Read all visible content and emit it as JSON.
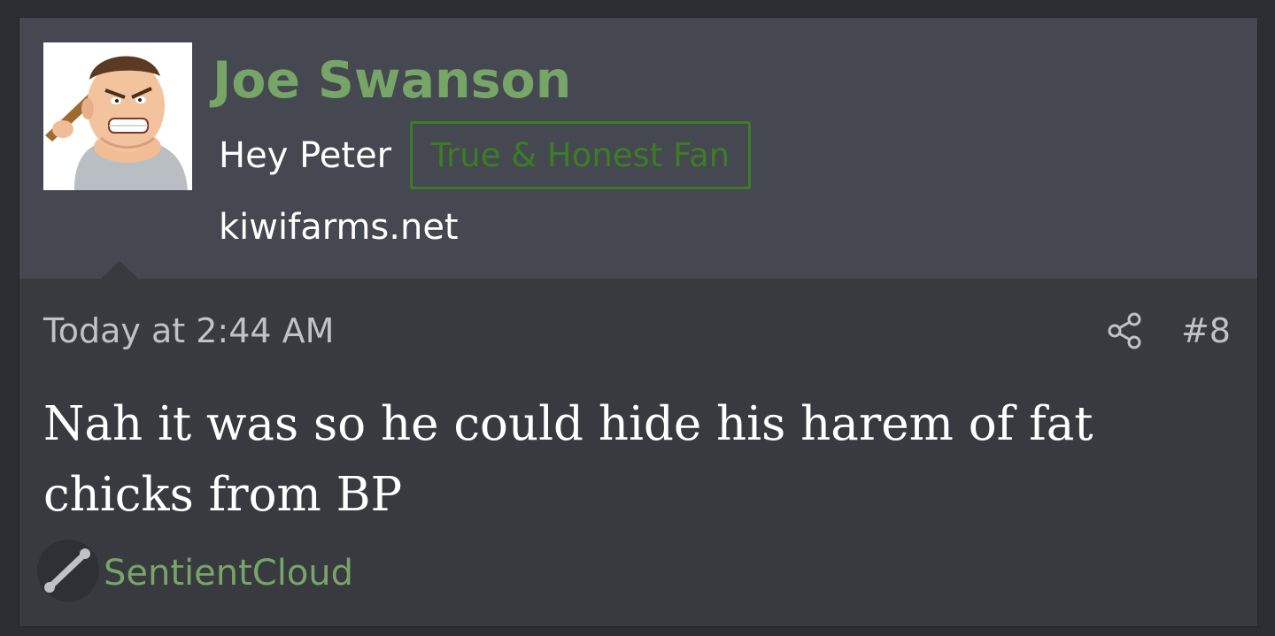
{
  "post": {
    "username": "Joe Swanson",
    "user_title": "Hey Peter",
    "user_banner": "True & Honest Fan",
    "user_location": "kiwifarms.net",
    "date": "Today at 2:44 AM",
    "post_number": "#8",
    "body": "Nah it was so he could hide his harem of fat chicks from BP",
    "reaction_user": "SentientCloud"
  },
  "icons": {
    "share": "share-icon",
    "reaction_avatar": "default-avatar-icon"
  },
  "colors": {
    "username": "#77a467",
    "banner": "#3b7d25",
    "header_bg": "#454850",
    "body_bg": "#383a40"
  }
}
